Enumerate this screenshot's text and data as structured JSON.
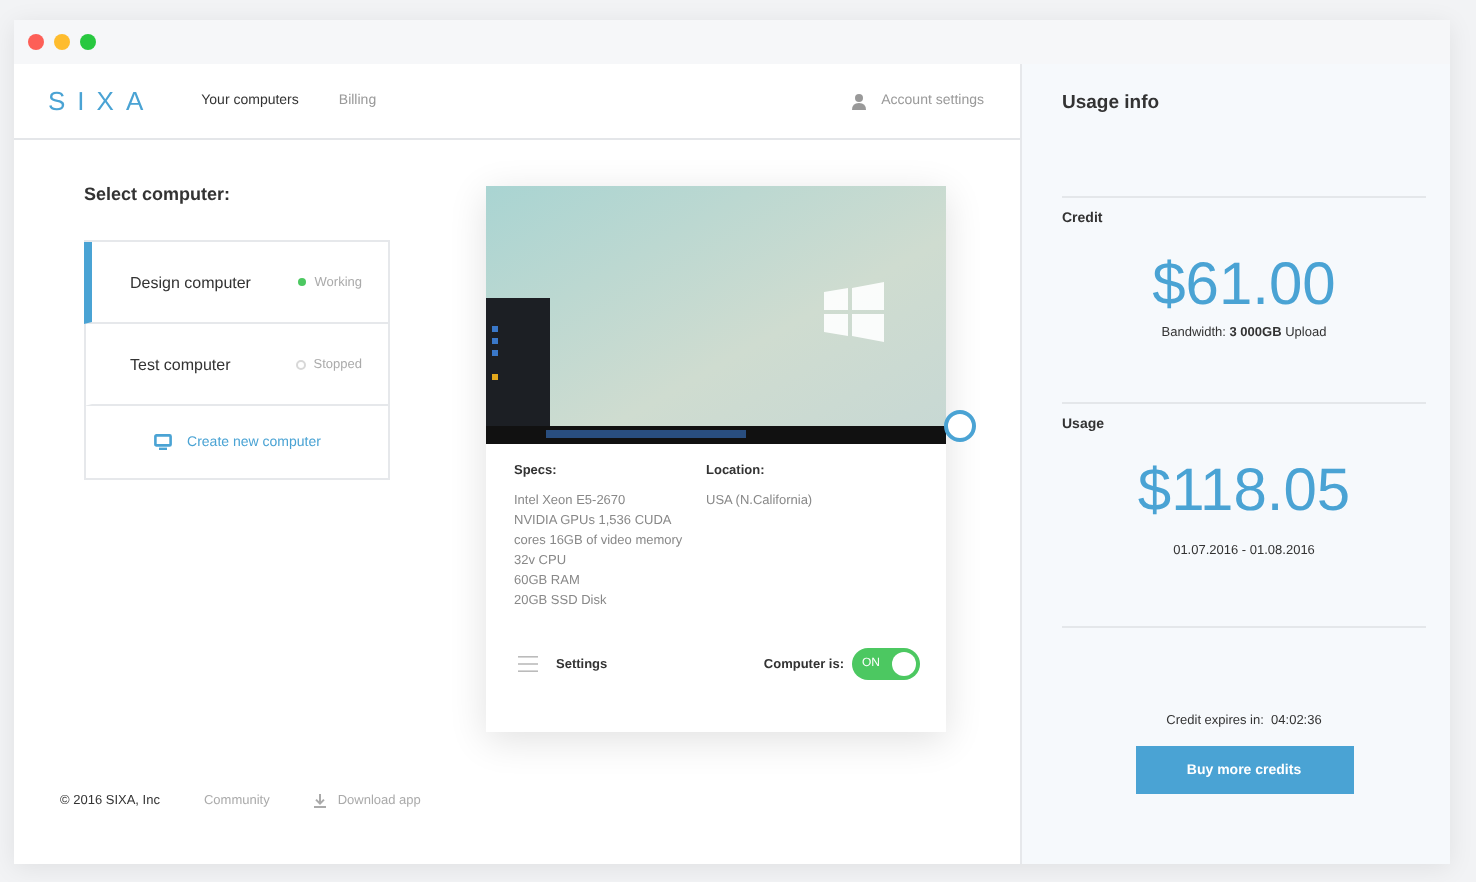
{
  "header": {
    "logo": "SIXA",
    "tabs": [
      {
        "label": "Your computers",
        "selected": true
      },
      {
        "label": "Billing",
        "selected": false
      }
    ],
    "account": "Account settings"
  },
  "select_title": "Select computer:",
  "computers": [
    {
      "name": "Design computer",
      "status": "Working",
      "selected": true,
      "color": "#4cc861"
    },
    {
      "name": "Test computer",
      "status": "Stopped",
      "selected": false,
      "color": "#d8d8d8"
    }
  ],
  "create_label": "Create new computer",
  "card": {
    "specs_title": "Specs:",
    "specs": [
      "Intel Xeon E5-2670",
      "NVIDIA GPUs 1,536 CUDA",
      "cores 16GB of video memory",
      "32v CPU",
      "60GB RAM",
      "20GB SSD Disk"
    ],
    "location_title": "Location:",
    "location": "USA (N.California)",
    "settings": "Settings",
    "power_label": "Computer is:",
    "power": {
      "on": true,
      "label": "ON"
    }
  },
  "footer": {
    "copyright": "© 2016 SIXA, Inc",
    "links": [
      {
        "label": "Community",
        "kind": "plain"
      },
      {
        "label": "Download app",
        "kind": "download"
      }
    ]
  },
  "usage": {
    "title": "Usage info",
    "credit_title": "Credit",
    "credit": "$61.00",
    "bandwidth": "Bandwidth: **3 000GB** Upload",
    "usage_title": "Usage",
    "usage": "$118.05",
    "period": "01.07.2016 - 01.08.2016",
    "expires": "Credit expires in:  04:02:36",
    "button": "Buy more credits"
  }
}
